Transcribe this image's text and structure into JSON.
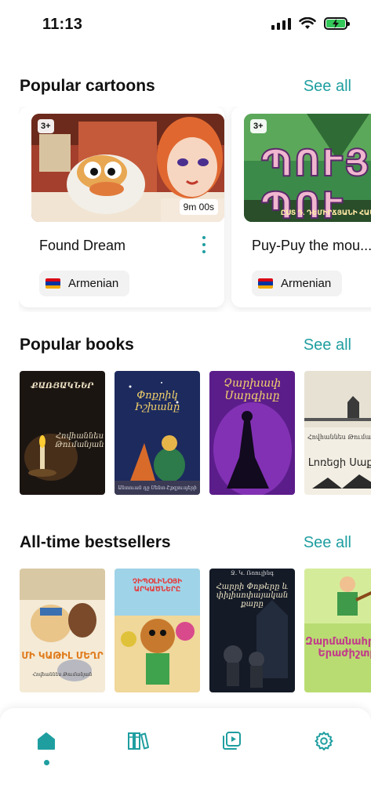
{
  "status_bar": {
    "time": "11:13",
    "icons": [
      "cellular-signal-icon",
      "wifi-icon",
      "battery-charging-icon"
    ]
  },
  "colors": {
    "accent": "#1f9ea0",
    "battery": "#34c759",
    "text": "#111111",
    "chip_bg": "#f2f2f2"
  },
  "popular_cartoons": {
    "title": "Popular cartoons",
    "see_all": "See all",
    "items": [
      {
        "title": "Found Dream",
        "age": "3+",
        "duration": "9m 00s",
        "language": "Armenian",
        "menu_icon": "more-vertical-icon"
      },
      {
        "title": "Puy-Puy the mou...",
        "age": "3+",
        "thumb_text": "ՊՈՒՅ-ՊՈՒ",
        "thumb_caption": "ԸՍՏ Դ. ԴԵՄԻՐՃՅԱՆԻ ՀԱՄԱՆՈՒՆ",
        "language": "Armenian"
      }
    ]
  },
  "popular_books": {
    "title": "Popular books",
    "see_all": "See all",
    "items": [
      {
        "title": "ՔԱՌՅԱԿՆԵՐ",
        "author": "Հովհաննես Թումանյան"
      },
      {
        "title": "Փոքրիկ Իշխանը",
        "author": "Անտուան դը Սենտ-Էքզյուպերի"
      },
      {
        "title": "Չարխափ Սարգիսը",
        "author": ""
      },
      {
        "title": "Լոռեցի Սաքոն",
        "author": "Հովհաննես Թումանյան"
      }
    ]
  },
  "bestsellers": {
    "title": "All-time bestsellers",
    "see_all": "See all",
    "items": [
      {
        "title": "ՄԻ ԿԱԹԻԼ ՄԵՂՐ",
        "author": "Հովհաննես Թումանյան"
      },
      {
        "title": "ՉԻՊՕԼԻՆՕՅԻ ԱՐԿԱԾՆԵՐԸ",
        "author": ""
      },
      {
        "title": "Հարրի Փոթերը և փիլիսոփայական քարը",
        "author": "Ջ. Կ. Ռոուլինգ"
      },
      {
        "title": "Զարմանահրաշ Երաժիշտը",
        "author": ""
      }
    ]
  },
  "bottom_nav": {
    "items": [
      {
        "name": "home",
        "icon": "home-icon",
        "active": true
      },
      {
        "name": "library",
        "icon": "books-icon",
        "active": false
      },
      {
        "name": "videos",
        "icon": "video-playlist-icon",
        "active": false
      },
      {
        "name": "settings",
        "icon": "gear-icon",
        "active": false
      }
    ]
  }
}
